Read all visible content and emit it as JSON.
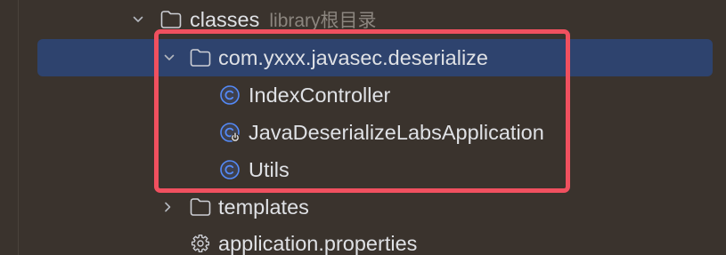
{
  "project_tree": {
    "items": [
      {
        "label": "classes",
        "hint": "library根目录",
        "icon": "folder-icon",
        "toggle_icon": "chevron-down-icon",
        "expanded": true,
        "selected": false
      },
      {
        "label": "com.yxxx.javasec.deserialize",
        "icon": "folder-icon",
        "toggle_icon": "chevron-down-icon",
        "expanded": true,
        "selected": true
      },
      {
        "label": "IndexController",
        "icon": "class-icon",
        "selected": false
      },
      {
        "label": "JavaDeserializeLabsApplication",
        "icon": "spring-boot-application-class-icon",
        "selected": false
      },
      {
        "label": "Utils",
        "icon": "class-icon",
        "selected": false
      },
      {
        "label": "templates",
        "icon": "folder-icon",
        "toggle_icon": "chevron-right-icon",
        "expanded": false,
        "selected": false
      },
      {
        "label": "application.properties",
        "icon": "gear-icon",
        "selected": false
      }
    ]
  },
  "colors": {
    "background": "#3a332d",
    "selection": "#2e436e",
    "text": "#dfe1e5",
    "hint_text": "#8b857e",
    "class_icon": "#548af7",
    "annotation_border": "#f0505f"
  }
}
